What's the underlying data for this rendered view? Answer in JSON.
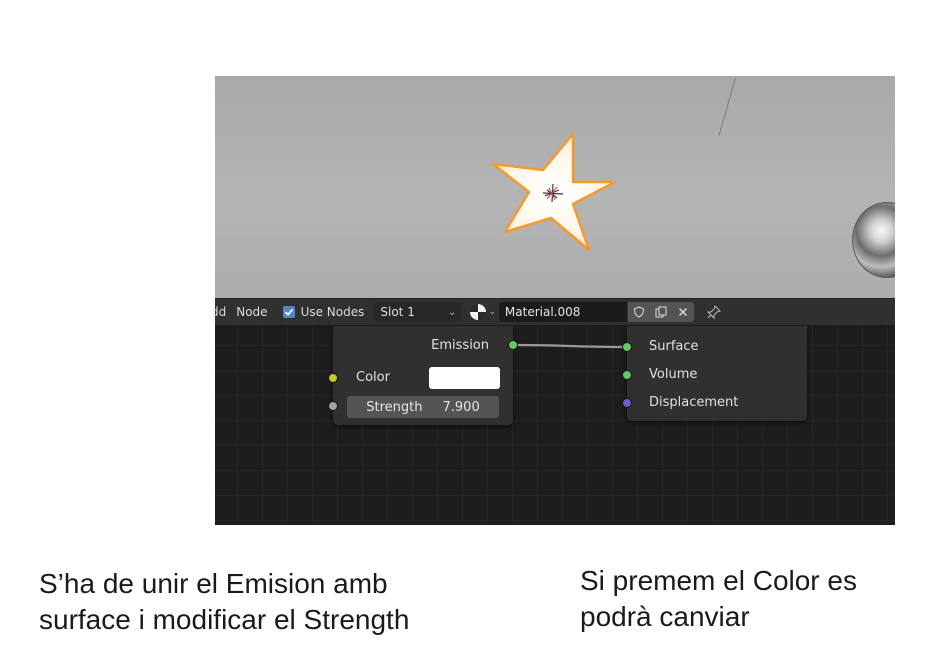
{
  "header": {
    "add_menu": "dd",
    "node_menu": "Node",
    "use_nodes_label": "Use Nodes",
    "use_nodes_checked": true,
    "slot_value": "Slot 1",
    "material_name": "Material.008",
    "accent_color": "#4f86c8"
  },
  "emission_node": {
    "output_label": "Emission",
    "color_label": "Color",
    "color_value": "#ffffff",
    "strength_label": "Strength",
    "strength_value": "7.900"
  },
  "output_node": {
    "surface_label": "Surface",
    "volume_label": "Volume",
    "displacement_label": "Displacement"
  },
  "icons": [
    "checkbox-icon",
    "shading-ball-icon",
    "fake-user-shield-icon",
    "duplicate-icon",
    "unlink-x-icon",
    "pin-icon",
    "star-light-object"
  ],
  "captions": {
    "left_line1": "S’ha de unir el Emision amb",
    "left_line2": "surface i modificar el Strength",
    "right_line1": "Si premem el Color es",
    "right_line2": "podrà canviar"
  }
}
